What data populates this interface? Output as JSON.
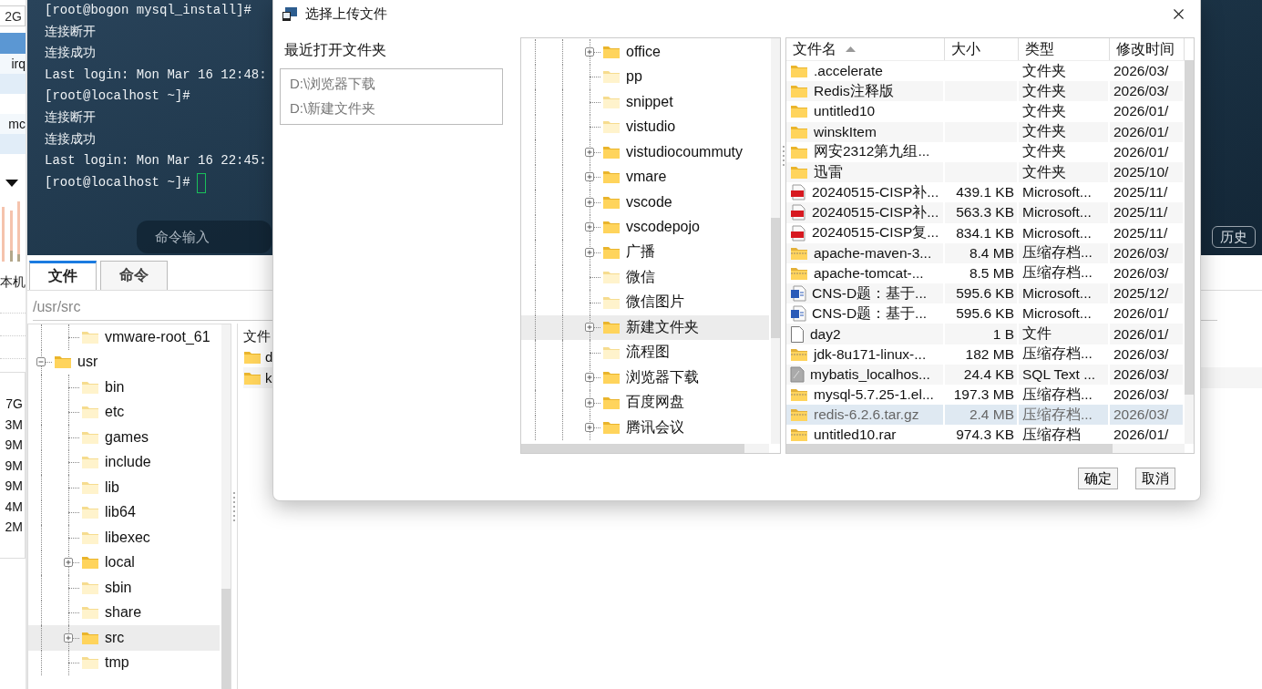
{
  "left_strip": {
    "disk": "2G",
    "rows": [
      "irq",
      "mc"
    ],
    "label": "本机",
    "sizes": [
      "7G",
      "3M",
      "9M",
      "9M",
      "9M",
      "4M",
      "2M"
    ]
  },
  "terminal": {
    "lines": [
      "[root@bogon mysql_install]#",
      "连接断开",
      "连接成功",
      "Last login: Mon Mar 16 12:48:",
      "[root@localhost ~]#",
      "连接断开",
      "连接成功",
      "Last login: Mon Mar 16 22:45:",
      "[root@localhost ~]#"
    ],
    "command_placeholder": "命令输入",
    "history_button": "历史"
  },
  "tabs": [
    {
      "label": "文件",
      "selected": true
    },
    {
      "label": "命令",
      "selected": false
    }
  ],
  "path": "/usr/src",
  "remote_tree": {
    "above": [
      {
        "label": "vmware-root_61",
        "expandable": false,
        "selected": false
      }
    ],
    "nodes": [
      {
        "label": "usr",
        "expandable": true,
        "expanded": true,
        "selected": false,
        "children": [
          {
            "label": "bin",
            "expandable": false,
            "selected": false
          },
          {
            "label": "etc",
            "expandable": false,
            "selected": false
          },
          {
            "label": "games",
            "expandable": false,
            "selected": false
          },
          {
            "label": "include",
            "expandable": false,
            "selected": false
          },
          {
            "label": "lib",
            "expandable": false,
            "selected": false
          },
          {
            "label": "lib64",
            "expandable": false,
            "selected": false
          },
          {
            "label": "libexec",
            "expandable": false,
            "selected": false
          },
          {
            "label": "local",
            "expandable": true,
            "selected": false
          },
          {
            "label": "sbin",
            "expandable": false,
            "selected": false
          },
          {
            "label": "share",
            "expandable": false,
            "selected": false
          },
          {
            "label": "src",
            "expandable": true,
            "selected": true
          },
          {
            "label": "tmp",
            "expandable": false,
            "selected": false
          }
        ]
      }
    ]
  },
  "file_panel": {
    "header": "文件",
    "items": [
      "d",
      "k"
    ]
  },
  "dialog": {
    "title": "选择上传文件",
    "recent_label": "最近打开文件夹",
    "recent": [
      "D:\\浏览器下载",
      "D:\\新建文件夹"
    ],
    "folders": [
      {
        "label": "office",
        "expandable": true,
        "selected": false
      },
      {
        "label": "pp",
        "expandable": false,
        "selected": false
      },
      {
        "label": "snippet",
        "expandable": false,
        "selected": false
      },
      {
        "label": "vistudio",
        "expandable": false,
        "selected": false
      },
      {
        "label": "vistudiocoummuty",
        "expandable": true,
        "selected": false
      },
      {
        "label": "vmare",
        "expandable": true,
        "selected": false
      },
      {
        "label": "vscode",
        "expandable": true,
        "selected": false
      },
      {
        "label": "vscodepojo",
        "expandable": true,
        "selected": false
      },
      {
        "label": "广播",
        "expandable": true,
        "selected": false
      },
      {
        "label": "微信",
        "expandable": false,
        "selected": false
      },
      {
        "label": "微信图片",
        "expandable": false,
        "selected": false
      },
      {
        "label": "新建文件夹",
        "expandable": true,
        "selected": true
      },
      {
        "label": "流程图",
        "expandable": false,
        "selected": false
      },
      {
        "label": "浏览器下载",
        "expandable": true,
        "selected": false
      },
      {
        "label": "百度网盘",
        "expandable": true,
        "selected": false
      },
      {
        "label": "腾讯会议",
        "expandable": true,
        "selected": false
      }
    ],
    "columns": [
      {
        "label": "文件名",
        "sorted": true
      },
      {
        "label": "大小",
        "sorted": false
      },
      {
        "label": "类型",
        "sorted": false
      },
      {
        "label": "修改时间",
        "sorted": false
      }
    ],
    "files": [
      {
        "kind": "folder",
        "name": ".accelerate",
        "type": "文件夹",
        "modified": "2026/03/",
        "selected": false
      },
      {
        "kind": "folder",
        "name": "Redis注释版",
        "type": "文件夹",
        "modified": "2026/03/",
        "selected": false
      },
      {
        "kind": "folder",
        "name": "untitled10",
        "type": "文件夹",
        "modified": "2026/01/",
        "selected": false
      },
      {
        "kind": "folder",
        "name": "winskItem",
        "type": "文件夹",
        "modified": "2026/01/",
        "selected": false
      },
      {
        "kind": "folder",
        "name": "网安2312第九组...",
        "type": "文件夹",
        "modified": "2026/01/",
        "selected": false
      },
      {
        "kind": "folder",
        "name": "迅雷",
        "type": "文件夹",
        "modified": "2025/10/",
        "selected": false
      },
      {
        "kind": "pdf",
        "name": "20240515-CISP补...",
        "size": "439.1 KB",
        "type": "Microsoft...",
        "modified": "2025/11/",
        "selected": false
      },
      {
        "kind": "pdf",
        "name": "20240515-CISP补...",
        "size": "563.3 KB",
        "type": "Microsoft...",
        "modified": "2025/11/",
        "selected": false
      },
      {
        "kind": "pdf",
        "name": "20240515-CISP复...",
        "size": "834.1 KB",
        "type": "Microsoft...",
        "modified": "2025/11/",
        "selected": false
      },
      {
        "kind": "archive",
        "name": "apache-maven-3...",
        "size": "8.4 MB",
        "type": "压缩存档...",
        "modified": "2026/03/",
        "selected": false
      },
      {
        "kind": "archive",
        "name": "apache-tomcat-...",
        "size": "8.5 MB",
        "type": "压缩存档...",
        "modified": "2026/03/",
        "selected": false
      },
      {
        "kind": "word",
        "name": "CNS-D题：基于...",
        "size": "595.6 KB",
        "type": "Microsoft...",
        "modified": "2025/12/",
        "selected": false
      },
      {
        "kind": "word",
        "name": "CNS-D题：基于...",
        "size": "595.6 KB",
        "type": "Microsoft...",
        "modified": "2026/01/",
        "selected": false
      },
      {
        "kind": "file",
        "name": "day2",
        "size": "1 B",
        "type": "文件",
        "modified": "2026/01/",
        "selected": false
      },
      {
        "kind": "archive",
        "name": "jdk-8u171-linux-...",
        "size": "182 MB",
        "type": "压缩存档...",
        "modified": "2026/03/",
        "selected": false
      },
      {
        "kind": "sql",
        "name": "mybatis_localhos...",
        "size": "24.4 KB",
        "type": "SQL Text ...",
        "modified": "2026/03/",
        "selected": false
      },
      {
        "kind": "archive",
        "name": "mysql-5.7.25-1.el...",
        "size": "197.3 MB",
        "type": "压缩存档...",
        "modified": "2026/03/",
        "selected": false
      },
      {
        "kind": "archive",
        "name": "redis-6.2.6.tar.gz",
        "size": "2.4 MB",
        "type": "压缩存档...",
        "modified": "2026/03/",
        "selected": true
      },
      {
        "kind": "archive",
        "name": "untitled10.rar",
        "size": "974.3 KB",
        "type": "压缩存档",
        "modified": "2026/01/",
        "selected": false
      }
    ],
    "buttons": [
      "确定",
      "取消"
    ]
  }
}
